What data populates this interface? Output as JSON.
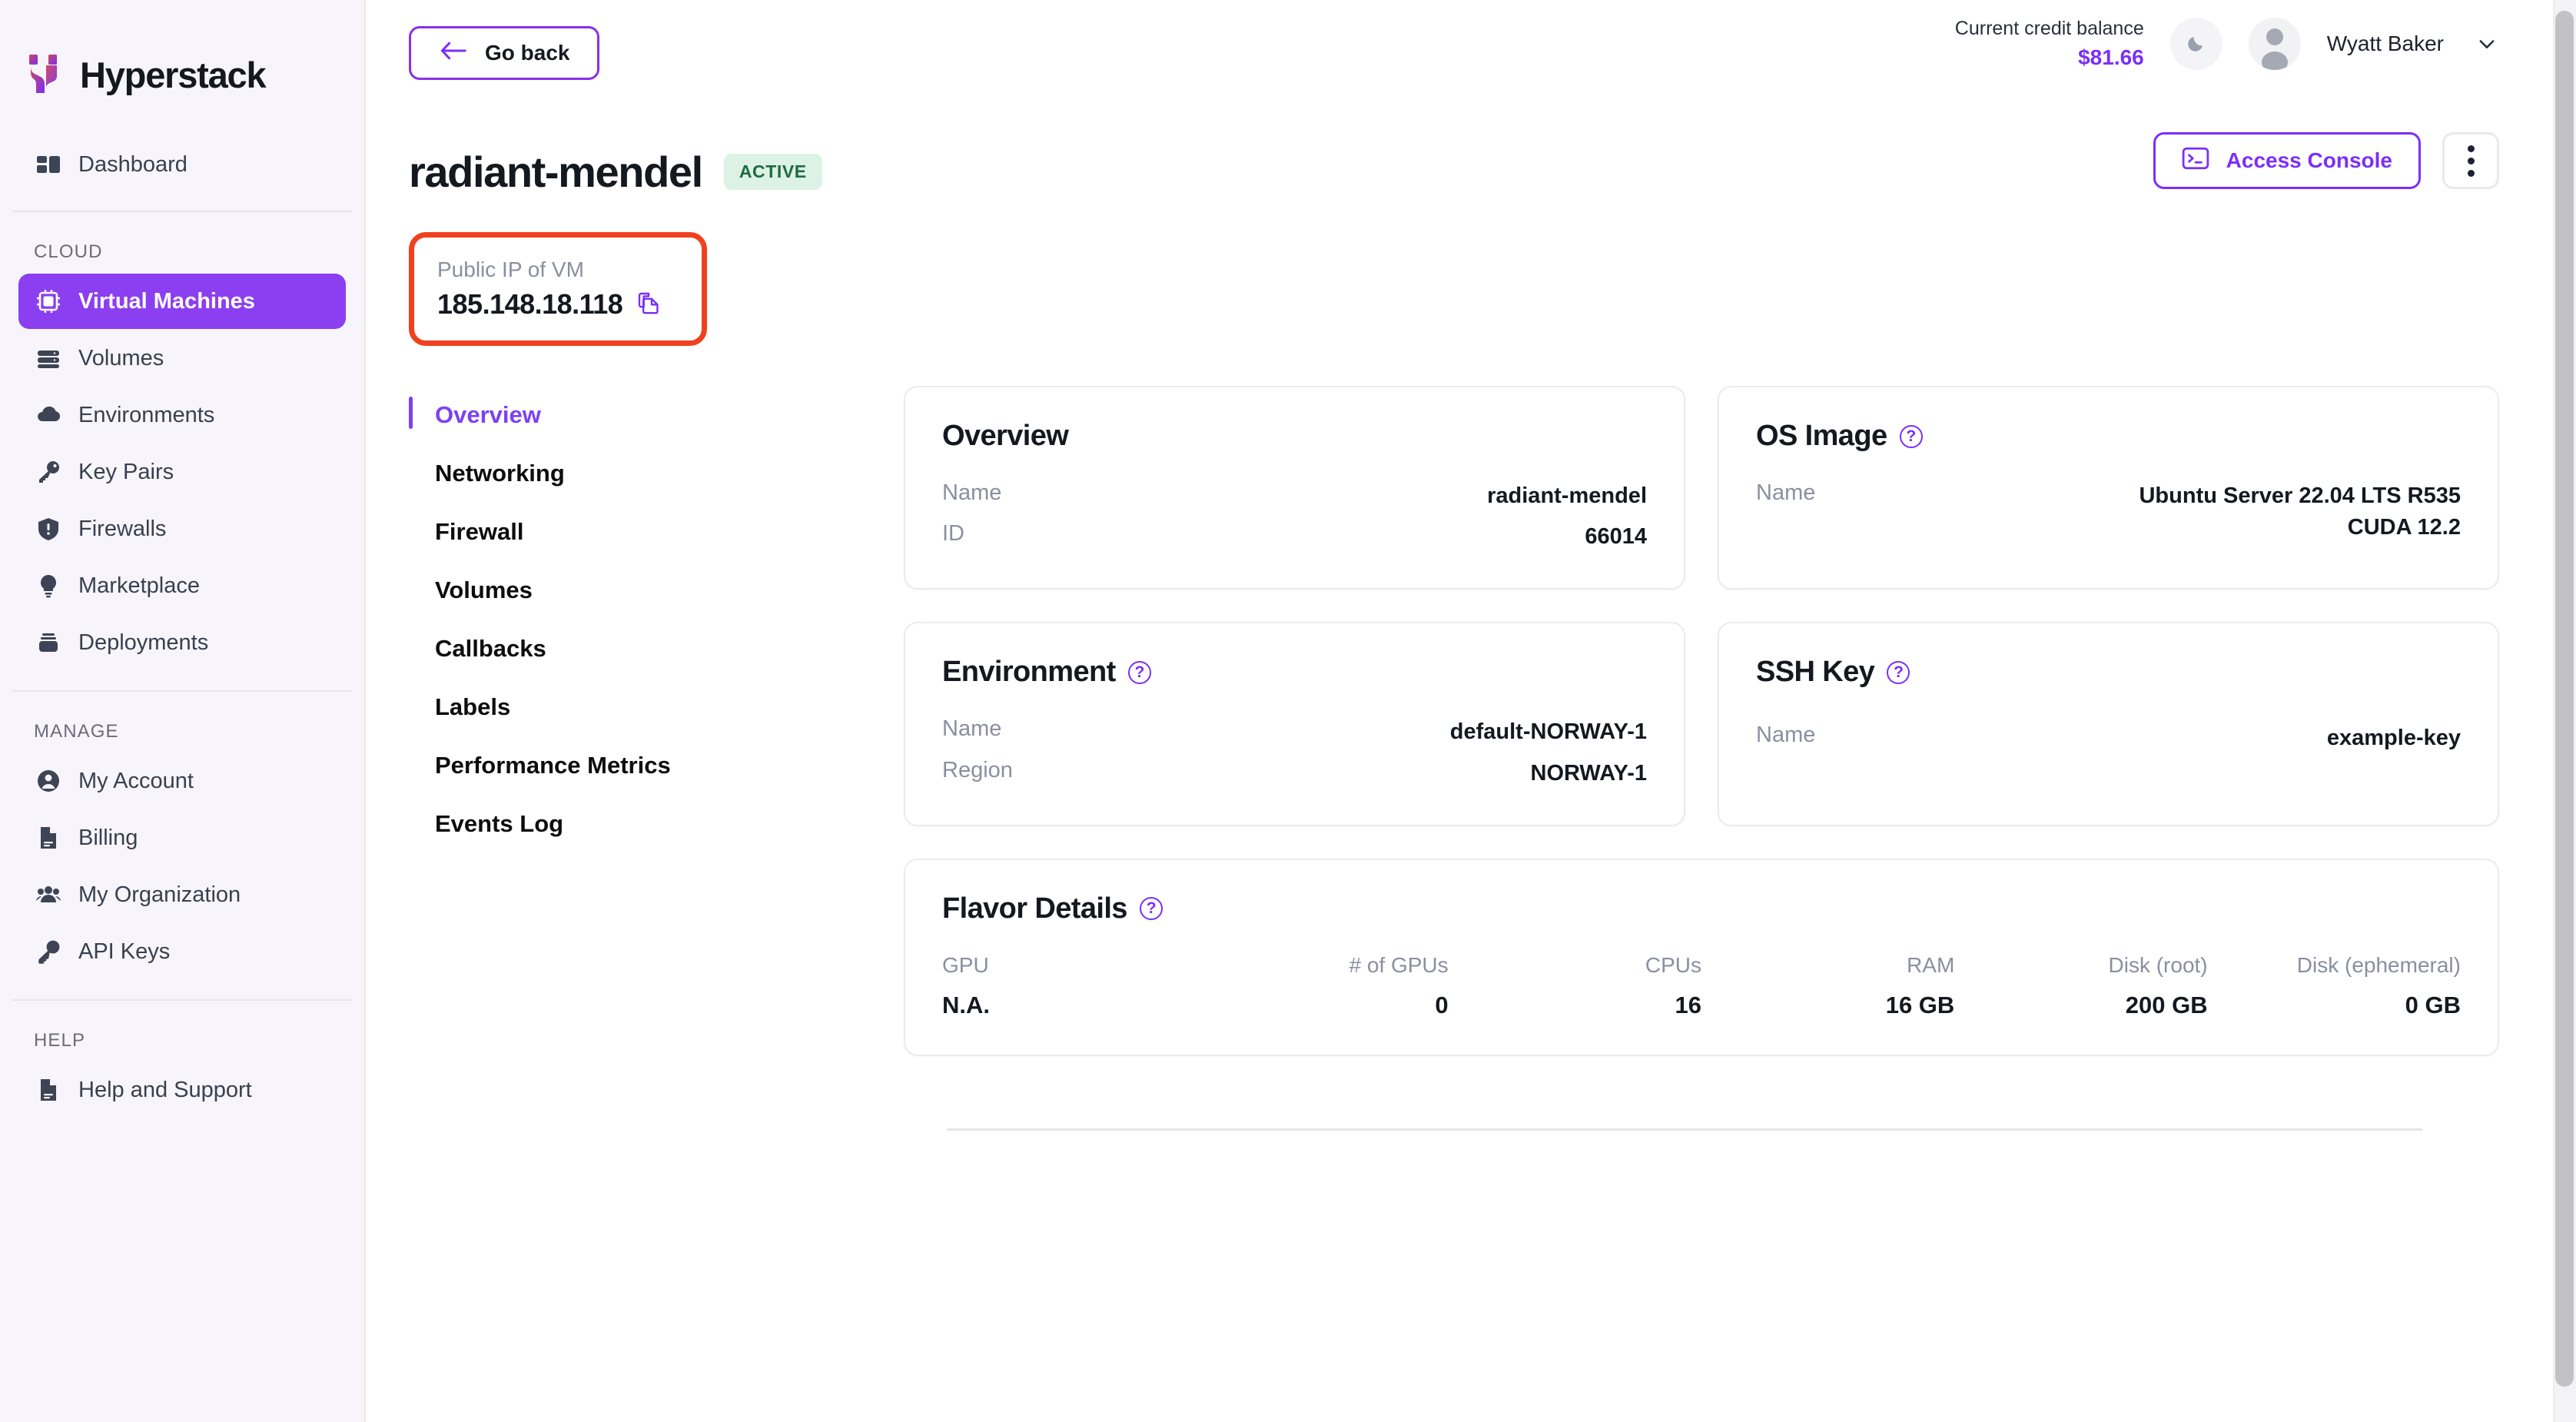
{
  "brand": {
    "name": "Hyperstack",
    "logo_icon": "hyperstack-logo"
  },
  "sidebar": {
    "top_items": [
      {
        "label": "Dashboard",
        "icon": "dashboard-icon",
        "active": false
      }
    ],
    "sections": [
      {
        "heading": "CLOUD",
        "items": [
          {
            "label": "Virtual Machines",
            "icon": "cpu-chip-icon",
            "active": true
          },
          {
            "label": "Volumes",
            "icon": "database-stack-icon",
            "active": false
          },
          {
            "label": "Environments",
            "icon": "cloud-icon",
            "active": false
          },
          {
            "label": "Key Pairs",
            "icon": "key-icon",
            "active": false
          },
          {
            "label": "Firewalls",
            "icon": "shield-alert-icon",
            "active": false
          },
          {
            "label": "Marketplace",
            "icon": "lightbulb-icon",
            "active": false
          },
          {
            "label": "Deployments",
            "icon": "deployments-icon",
            "active": false
          }
        ]
      },
      {
        "heading": "MANAGE",
        "items": [
          {
            "label": "My Account",
            "icon": "user-circle-icon",
            "active": false
          },
          {
            "label": "Billing",
            "icon": "document-icon",
            "active": false
          },
          {
            "label": "My Organization",
            "icon": "users-group-icon",
            "active": false
          },
          {
            "label": "API Keys",
            "icon": "key-outline-icon",
            "active": false
          }
        ]
      },
      {
        "heading": "HELP",
        "items": [
          {
            "label": "Help and Support",
            "icon": "document-icon",
            "active": false
          }
        ]
      }
    ]
  },
  "topbar": {
    "go_back_label": "Go back",
    "back_arrow_icon": "arrow-left-icon",
    "credit_label": "Current credit balance",
    "credit_value": "$81.66",
    "theme_toggle_icon": "moon-icon",
    "avatar_icon": "user-avatar-icon",
    "username": "Wyatt Baker",
    "chevron_icon": "chevron-down-icon"
  },
  "page_header": {
    "title": "radiant-mendel",
    "status_badge": "ACTIVE",
    "access_console_label": "Access Console",
    "console_icon": "terminal-icon",
    "kebab_icon": "more-vertical-icon"
  },
  "ip_card": {
    "label": "Public IP of VM",
    "value": "185.148.18.118",
    "copy_icon": "copy-icon",
    "highlight_color": "#f0401e"
  },
  "tabs": [
    {
      "label": "Overview",
      "active": true
    },
    {
      "label": "Networking",
      "active": false
    },
    {
      "label": "Firewall",
      "active": false
    },
    {
      "label": "Volumes",
      "active": false
    },
    {
      "label": "Callbacks",
      "active": false
    },
    {
      "label": "Labels",
      "active": false
    },
    {
      "label": "Performance Metrics",
      "active": false
    },
    {
      "label": "Events Log",
      "active": false
    }
  ],
  "cards": {
    "overview": {
      "title": "Overview",
      "has_help": false,
      "rows": [
        {
          "key": "Name",
          "value": "radiant-mendel"
        },
        {
          "key": "ID",
          "value": "66014"
        }
      ]
    },
    "os_image": {
      "title": "OS Image",
      "has_help": true,
      "help_icon": "help-circle-icon",
      "rows": [
        {
          "key": "Name",
          "value": "Ubuntu Server 22.04 LTS R535 CUDA 12.2"
        }
      ]
    },
    "environment": {
      "title": "Environment",
      "has_help": true,
      "help_icon": "help-circle-icon",
      "rows": [
        {
          "key": "Name",
          "value": "default-NORWAY-1"
        },
        {
          "key": "Region",
          "value": "NORWAY-1"
        }
      ]
    },
    "ssh_key": {
      "title": "SSH Key",
      "has_help": true,
      "help_icon": "help-circle-icon",
      "rows": [
        {
          "key": "Name",
          "value": "example-key"
        }
      ]
    },
    "flavor_details": {
      "title": "Flavor Details",
      "has_help": true,
      "help_icon": "help-circle-icon",
      "columns": [
        {
          "header": "GPU",
          "value": "N.A."
        },
        {
          "header": "# of GPUs",
          "value": "0"
        },
        {
          "header": "CPUs",
          "value": "16"
        },
        {
          "header": "RAM",
          "value": "16 GB"
        },
        {
          "header": "Disk (root)",
          "value": "200 GB"
        },
        {
          "header": "Disk (ephemeral)",
          "value": "0 GB"
        }
      ]
    }
  },
  "theme": {
    "accent_purple": "#7b2ff7",
    "active_nav_purple": "#8b3ff0",
    "badge_bg": "#dcf2e4",
    "badge_text": "#1d6b42",
    "highlight_red": "#f0401e",
    "sidebar_bg": "#f7f5fb"
  }
}
